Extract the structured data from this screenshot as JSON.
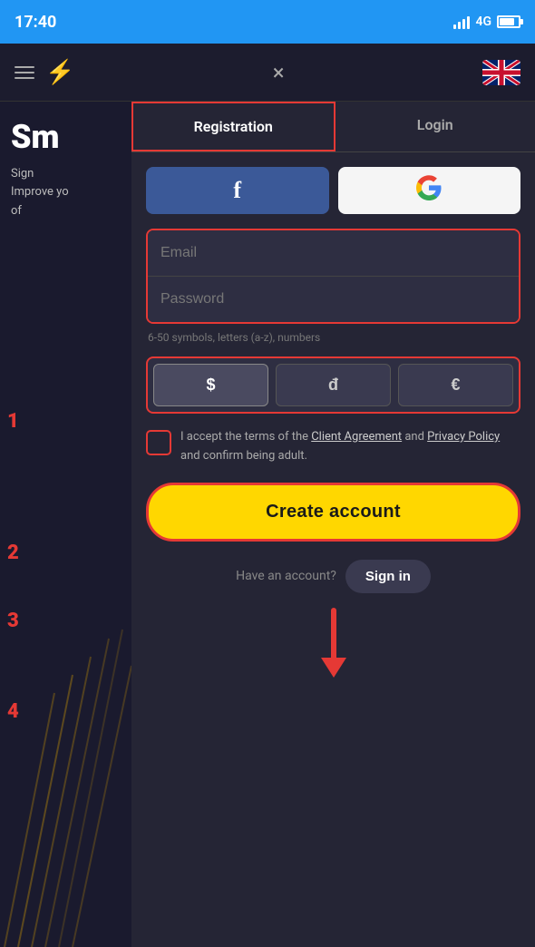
{
  "statusBar": {
    "time": "17:40",
    "network": "4G"
  },
  "appHeader": {
    "closeLabel": "×",
    "boltSymbol": "⚡"
  },
  "tabs": {
    "registration": "Registration",
    "login": "Login"
  },
  "socialButtons": {
    "facebook": "f",
    "google": "G"
  },
  "form": {
    "emailPlaceholder": "Email",
    "passwordPlaceholder": "Password",
    "passwordHint": "6-50 symbols, letters (a-z), numbers",
    "currencies": [
      "$",
      "đ",
      "€"
    ],
    "termsText": "I accept the terms of the ",
    "clientAgreement": "Client Agreement",
    "termsAnd": " and ",
    "privacyPolicy": "Privacy Policy",
    "termsSuffix": " and confirm being adult.",
    "createAccountBtn": "Create account"
  },
  "footer": {
    "haveAccountText": "Have an account?",
    "signInBtn": "Sign in"
  },
  "steps": {
    "s1": "1",
    "s2": "2",
    "s3": "3",
    "s4": "4"
  },
  "leftPanel": {
    "title": "Sm",
    "line1": "Sign",
    "line2": "Improve yo",
    "line3": "of"
  }
}
